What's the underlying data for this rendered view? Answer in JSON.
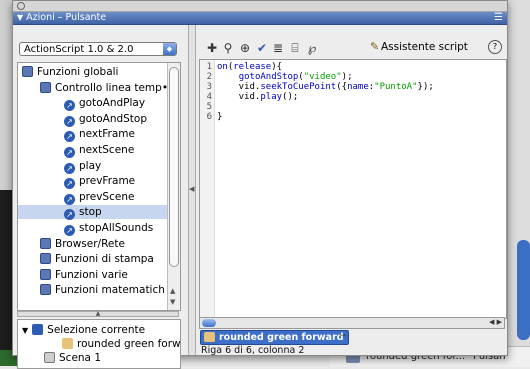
{
  "window": {
    "title": "Azioni – Pulsante",
    "collapse_glyph": "▼",
    "menu_icon": "options-menu-icon"
  },
  "left": {
    "language_select": "ActionScript 1.0 & 2.0",
    "tree": [
      {
        "label": "Funzioni globali",
        "level": 0,
        "icon": "book-icon"
      },
      {
        "label": "Controllo linea temp•",
        "level": 1,
        "icon": "book-icon"
      },
      {
        "label": "gotoAndPlay",
        "level": 2,
        "icon": "function-icon"
      },
      {
        "label": "gotoAndStop",
        "level": 2,
        "icon": "function-icon"
      },
      {
        "label": "nextFrame",
        "level": 2,
        "icon": "function-icon"
      },
      {
        "label": "nextScene",
        "level": 2,
        "icon": "function-icon"
      },
      {
        "label": "play",
        "level": 2,
        "icon": "function-icon"
      },
      {
        "label": "prevFrame",
        "level": 2,
        "icon": "function-icon"
      },
      {
        "label": "prevScene",
        "level": 2,
        "icon": "function-icon"
      },
      {
        "label": "stop",
        "level": 2,
        "icon": "function-icon",
        "selected": true
      },
      {
        "label": "stopAllSounds",
        "level": 2,
        "icon": "function-icon"
      },
      {
        "label": "Browser/Rete",
        "level": 1,
        "icon": "book-icon"
      },
      {
        "label": "Funzioni di stampa",
        "level": 1,
        "icon": "book-icon"
      },
      {
        "label": "Funzioni varie",
        "level": 1,
        "icon": "book-icon"
      },
      {
        "label": "Funzioni matematich",
        "level": 1,
        "icon": "book-icon"
      }
    ],
    "bottom_tree": {
      "current_selection": "Selezione corrente",
      "object": "rounded green forw",
      "scene": "Scena 1"
    }
  },
  "toolbar": {
    "icons": [
      "add-statement-icon",
      "find-icon",
      "target-icon",
      "check-syntax-icon",
      "auto-format-icon",
      "code-hint-icon",
      "debug-options-icon"
    ],
    "assistant_label": "Assistente script",
    "help_glyph": "?"
  },
  "editor": {
    "line_numbers": [
      "1",
      "2",
      "3",
      "4",
      "5",
      "6"
    ],
    "lines": [
      "on(release){",
      "    gotoAndStop(\"video\");",
      "    vid.seekToCuePoint({name:\"PuntoA\"});",
      "    vid.play();",
      "",
      "}"
    ]
  },
  "tab": {
    "label": "rounded green forward"
  },
  "status": "Riga 6 di 6, colonna 2",
  "background": {
    "panel_item": "rounded green for...",
    "panel_item_type": "Pulsan"
  }
}
